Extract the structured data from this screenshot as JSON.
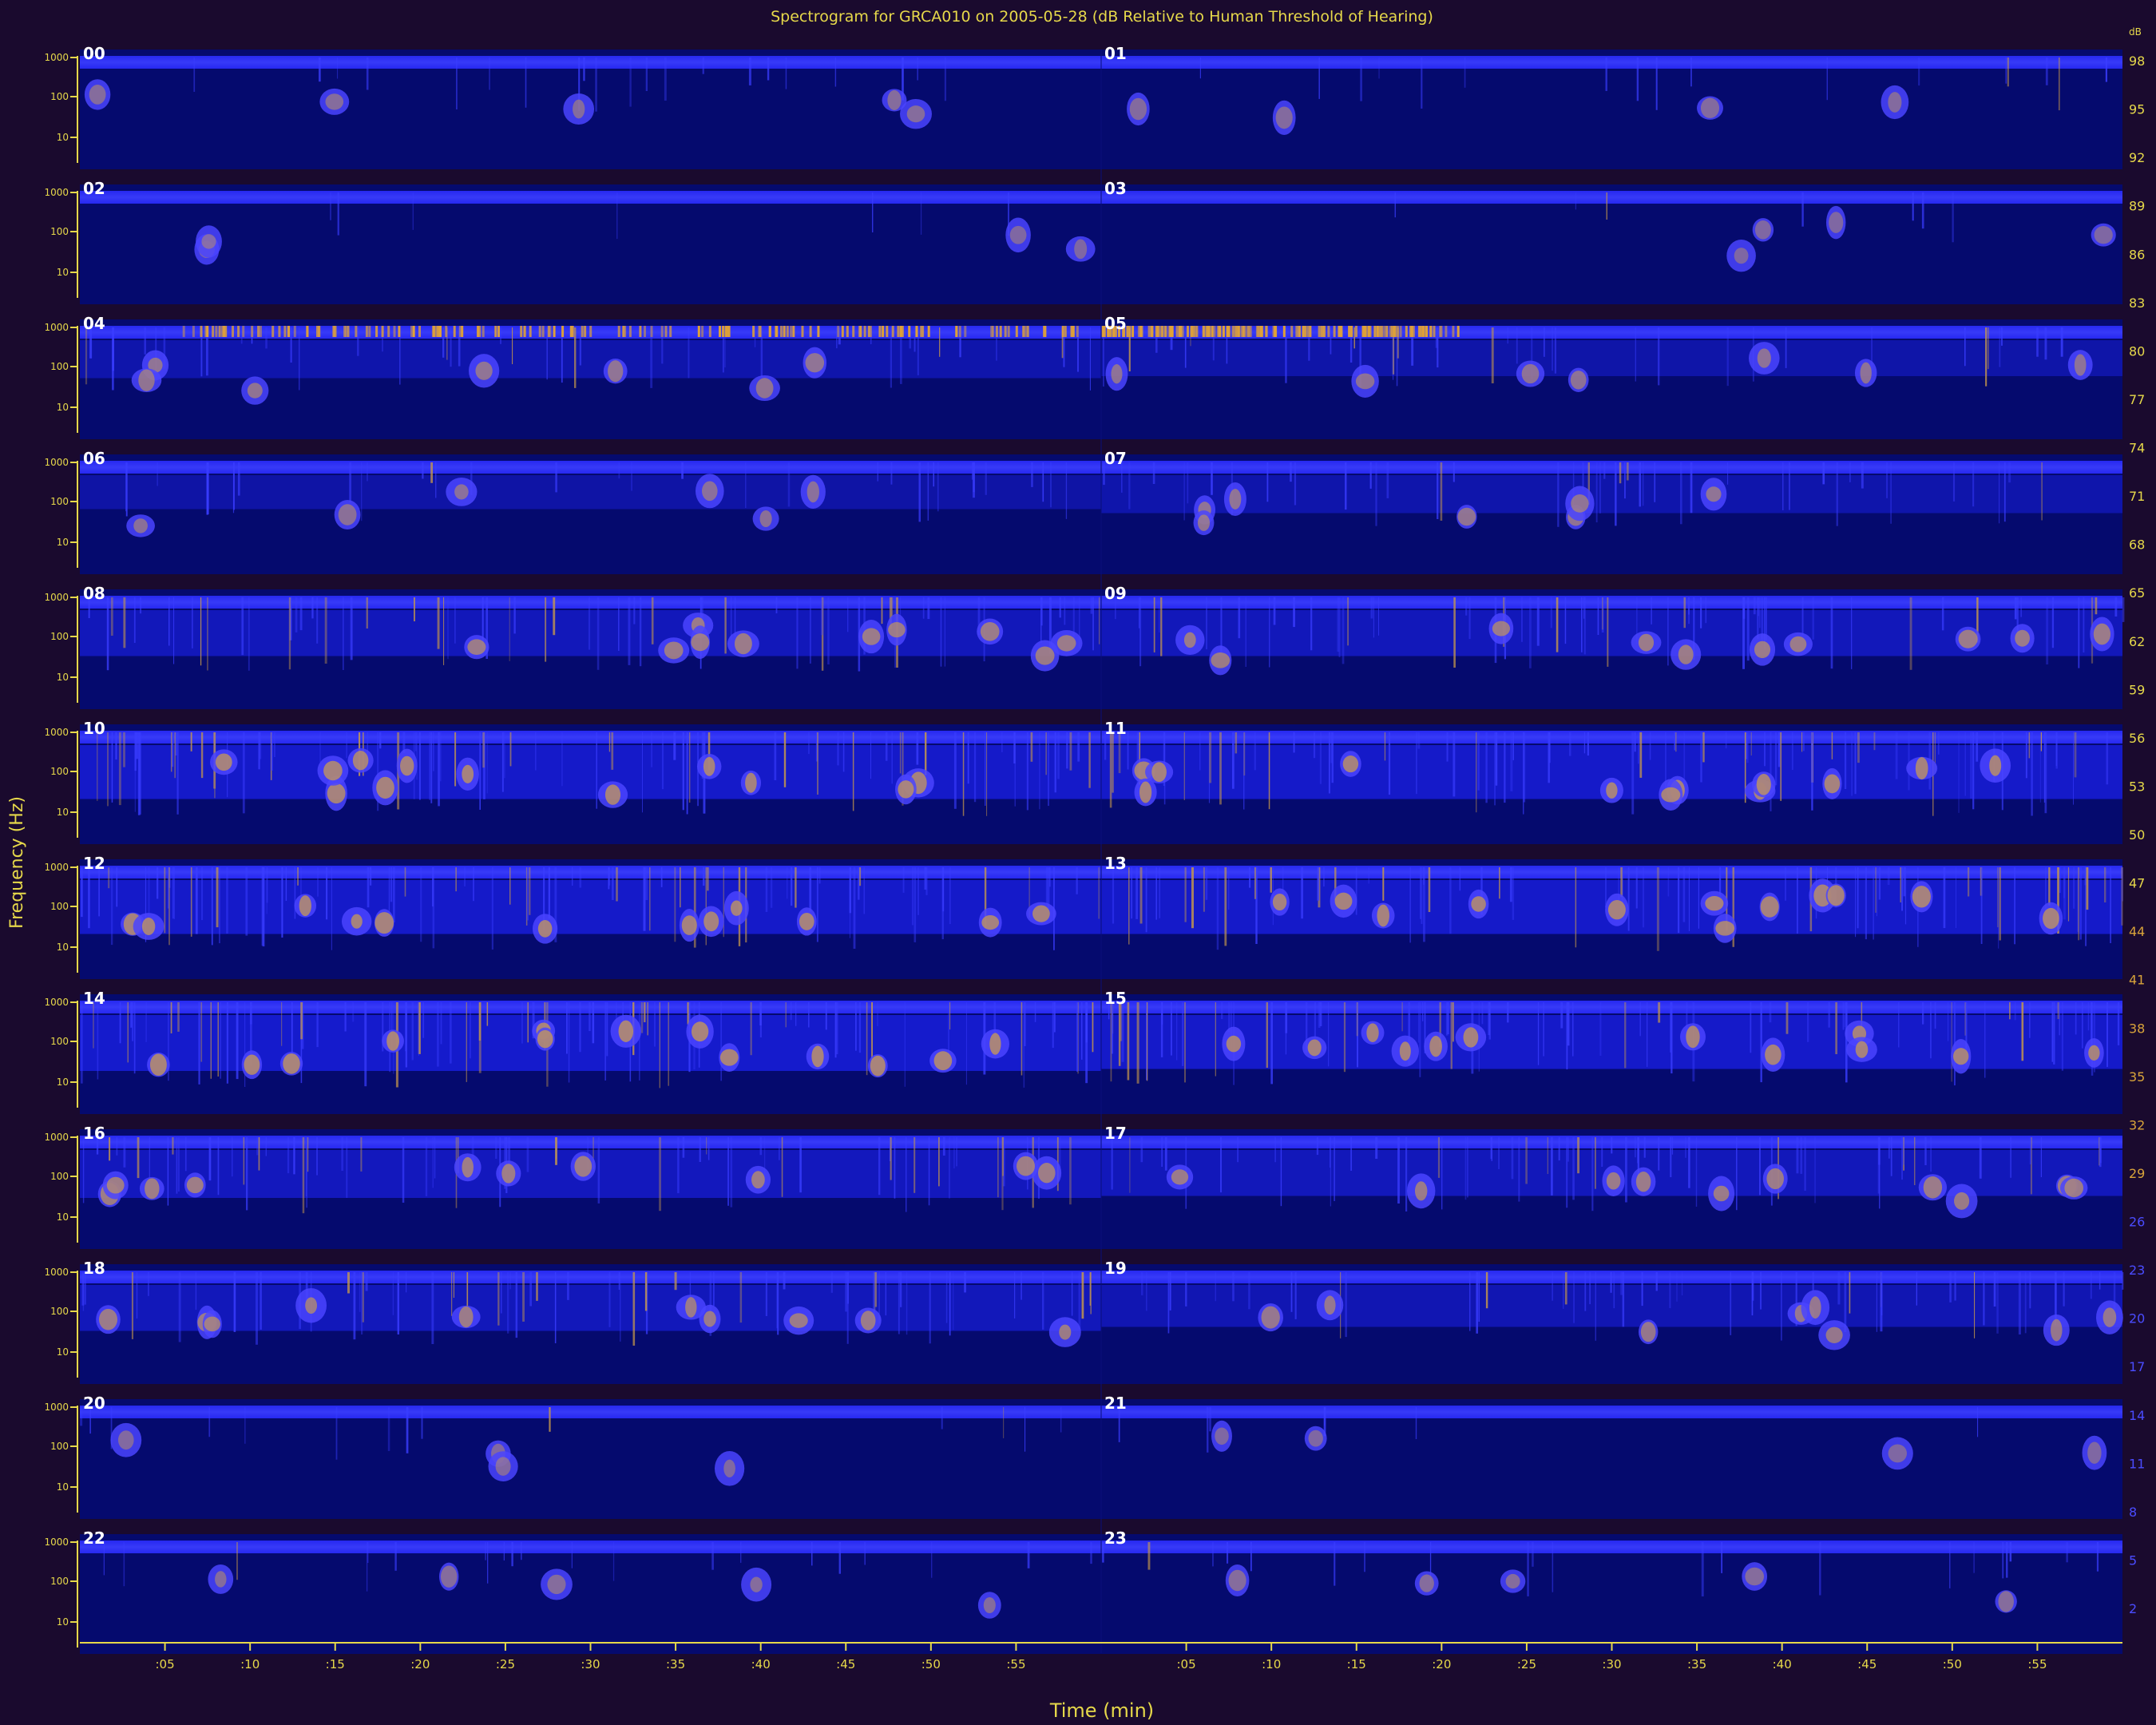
{
  "chart_data": {
    "type": "heatmap",
    "title": "Spectrogram for GRCA010 on 2005-05-28 (dB Relative to Human Threshold of Hearing)",
    "xlabel": "Time (min)",
    "ylabel": "Frequency (Hz)",
    "hour_labels": [
      "00",
      "01",
      "02",
      "03",
      "04",
      "05",
      "06",
      "07",
      "08",
      "09",
      "10",
      "11",
      "12",
      "13",
      "14",
      "15",
      "16",
      "17",
      "18",
      "19",
      "20",
      "21",
      "22",
      "23"
    ],
    "freq_ticks": [
      "1000",
      "100",
      "10"
    ],
    "time_ticks": [
      ":05",
      ":10",
      ":15",
      ":20",
      ":25",
      ":30",
      ":35",
      ":40",
      ":45",
      ":50",
      ":55"
    ],
    "time_tick_minutes": [
      5,
      10,
      15,
      20,
      25,
      30,
      35,
      40,
      45,
      50,
      55
    ],
    "db_scale": [
      "98",
      "95",
      "92",
      "89",
      "86",
      "83",
      "80",
      "77",
      "74",
      "71",
      "68",
      "65",
      "62",
      "59",
      "56",
      "53",
      "50",
      "47",
      "44",
      "41",
      "38",
      "35",
      "32",
      "29",
      "26",
      "23",
      "20",
      "17",
      "14",
      "11",
      "8",
      "5",
      "2"
    ],
    "db_unit": "dB",
    "activity_level": [
      0.15,
      0.12,
      0.05,
      0.05,
      0.35,
      0.3,
      0.25,
      0.35,
      0.55,
      0.55,
      0.75,
      0.75,
      0.75,
      0.75,
      0.8,
      0.75,
      0.6,
      0.55,
      0.55,
      0.45,
      0.1,
      0.05,
      0.15,
      0.15
    ],
    "colors": {
      "background": "#1a0a2e",
      "low": "#050a6e",
      "mid": "#1f25ff",
      "high": "#d8a33a",
      "axis": "#e6d84a"
    }
  }
}
